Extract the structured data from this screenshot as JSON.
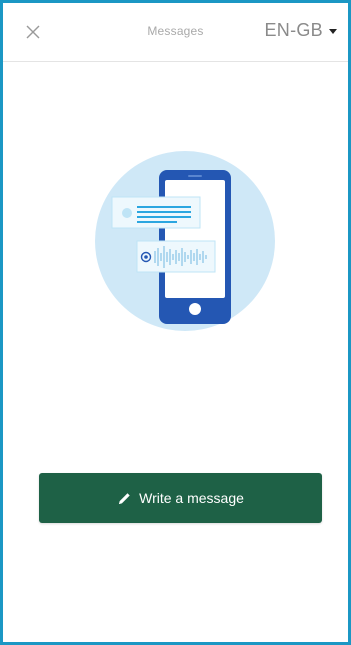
{
  "header": {
    "close_icon": "close-icon",
    "title": "Messages",
    "language": "EN-GB",
    "language_caret_icon": "caret-down-icon"
  },
  "illustration": {
    "icon": "phone-messaging-illustration"
  },
  "compose": {
    "label": "Write a message",
    "icon": "pencil-icon"
  },
  "colors": {
    "accent_border": "#1b97c4",
    "button_bg": "#1e6146",
    "illustration_circle": "#cfe8f7",
    "phone_body": "#2457b3"
  }
}
